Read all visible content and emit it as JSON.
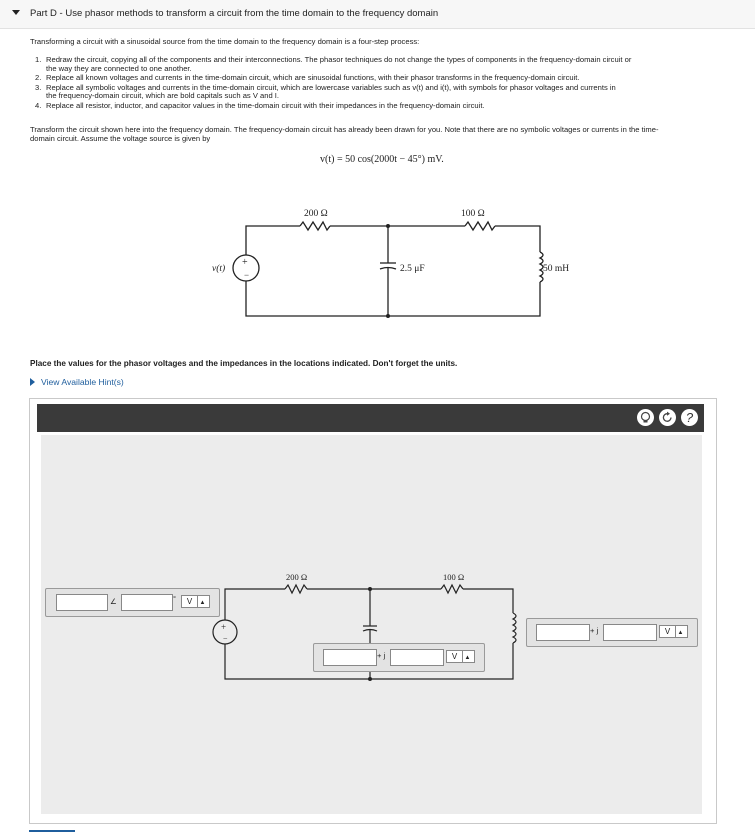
{
  "header": {
    "title": "Part D - Use phasor methods to transform a circuit from the time domain to the frequency domain"
  },
  "intro": "Transforming a circuit with a sinusoidal source from the time domain to the frequency domain is a four-step process:",
  "steps": [
    {
      "num": "1.",
      "line1": "Redraw the circuit, copying all of the components and their interconnections.  The phasor techniques do not change the types of components in the frequency-domain circuit or",
      "line2": "the way they are connected to one another."
    },
    {
      "num": "2.",
      "line1": "Replace all known voltages and currents in the time-domain circuit, which are sinusoidal functions, with their phasor transforms in the frequency-domain circuit."
    },
    {
      "num": "3.",
      "line1": "Replace all symbolic voltages and currents in the time-domain circuit, which are lowercase  variables such as v(t) and i(t), with symbols for phasor voltages and currents in",
      "line2": "the frequency-domain circuit, which are bold capitals such as V and I."
    },
    {
      "num": "4.",
      "line1": "Replace all resistor, inductor, and capacitor values in the time-domain circuit with their impedances in the frequency-domain circuit."
    }
  ],
  "transform_line1": "Transform the circuit shown here into the frequency domain.  The frequency-domain circuit has already been drawn for you.  Note that there are no symbolic voltages or currents in the time-",
  "transform_line2": "domain circuit. Assume the voltage source is given by",
  "equation": "v(t) = 50 cos(2000t − 45°) mV.",
  "circuit": {
    "r1": "200 Ω",
    "r2": "100 Ω",
    "c": "2.5 μF",
    "l": "50 mH",
    "source": "v(t)"
  },
  "place_text": "Place the values for the phasor voltages and the impedances in the locations indicated.  Don't forget the units.",
  "hint_text": "View Available Hint(s)",
  "toolbar": {
    "hint_icon": "lightbulb-icon",
    "reset_icon": "reset-icon",
    "help_label": "?"
  },
  "freq": {
    "r1": "200 Ω",
    "r2": "100 Ω",
    "source_angle_symbol": "∠",
    "degree": "°",
    "plus_j": "+ j",
    "unit": "V",
    "source_mag": "",
    "source_angle": "",
    "cap_real": "",
    "cap_imag": "",
    "ind_real": "",
    "ind_imag": ""
  }
}
